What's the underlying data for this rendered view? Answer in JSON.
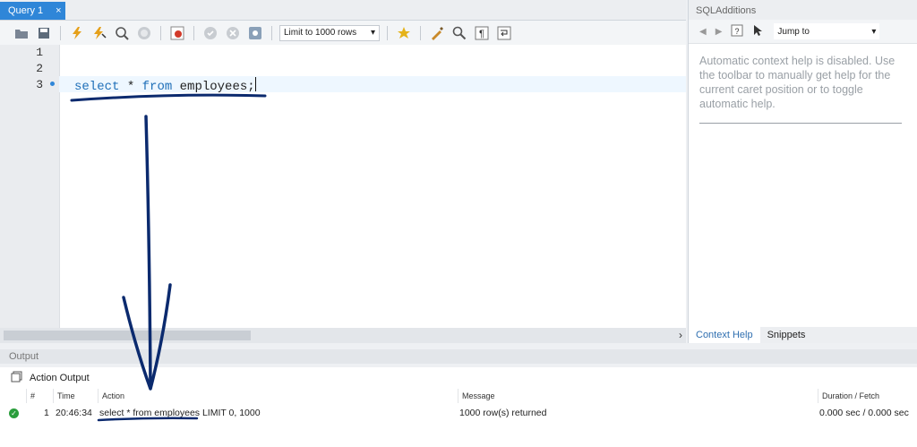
{
  "editor": {
    "tab_label": "Query 1",
    "tab_close": "×",
    "limit_label": "Limit to 1000 rows",
    "line_numbers": [
      "1",
      "2",
      "3"
    ],
    "code": {
      "kw1": "select",
      "star": " * ",
      "kw2": "from",
      "table": " employees;"
    }
  },
  "toolbar_icons": [
    "open-folder-icon",
    "save-icon",
    "execute-icon",
    "execute-current-icon",
    "explain-icon",
    "stop-icon",
    "toggle-errors-icon",
    "commit-icon",
    "rollback-icon",
    "autocommit-icon",
    "add-snippet-icon",
    "beautify-icon",
    "find-icon",
    "invisible-chars-icon",
    "wrap-lines-icon"
  ],
  "sql_additions": {
    "title": "SQLAdditions",
    "jump_to": "Jump to",
    "help_text": "Automatic context help is disabled. Use the toolbar to manually get help for the current caret position or to toggle automatic help.",
    "tabs": [
      "Context Help",
      "Snippets"
    ]
  },
  "output": {
    "header": "Output",
    "selector_label": "Action Output",
    "columns": {
      "num": "#",
      "time": "Time",
      "action": "Action",
      "message": "Message",
      "duration": "Duration / Fetch"
    },
    "rows": [
      {
        "num": "1",
        "time": "20:46:34",
        "action": "select * from employees LIMIT 0, 1000",
        "message": "1000 row(s) returned",
        "duration": "0.000 sec / 0.000 sec",
        "status": "success"
      }
    ]
  },
  "colors": {
    "accent": "#2f86d8",
    "keyword": "#1f6fb8",
    "annotation": "#0b2a6e",
    "success": "#2a9d3c"
  }
}
